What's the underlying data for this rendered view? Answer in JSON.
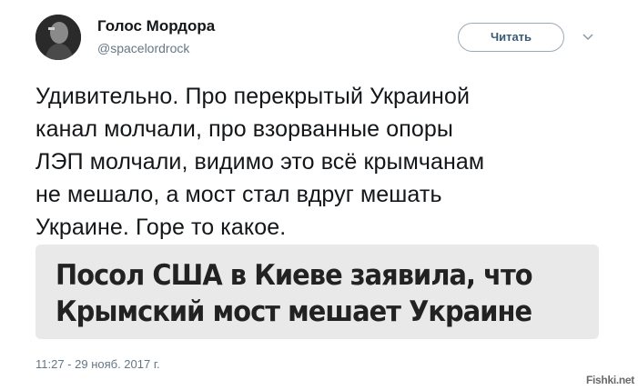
{
  "author": {
    "display_name": "Голос Мордора",
    "handle": "@spacelordrock"
  },
  "actions": {
    "follow_label": "Читать",
    "more_icon": "chevron-down-icon"
  },
  "tweet": {
    "text_lines": [
      "Удивительно. Про перекрытый Украиной",
      "канал молчали, про взорванные опоры",
      "ЛЭП молчали, видимо это всё крымчанам",
      "не мешало, а мост стал вдруг мешать",
      "Украине. Горе то какое."
    ],
    "media_headline_lines": [
      "Посол США в Киеве заявила, что",
      "Крымский мост мешает Украине"
    ],
    "timestamp": "11:27 - 29 нояб. 2017 г."
  },
  "watermark": "Fishki.net",
  "colors": {
    "secondary_text": "#657786",
    "follow_border": "#9aa9b6",
    "follow_text": "#3a5a75",
    "media_background": "#e9e9e9"
  }
}
